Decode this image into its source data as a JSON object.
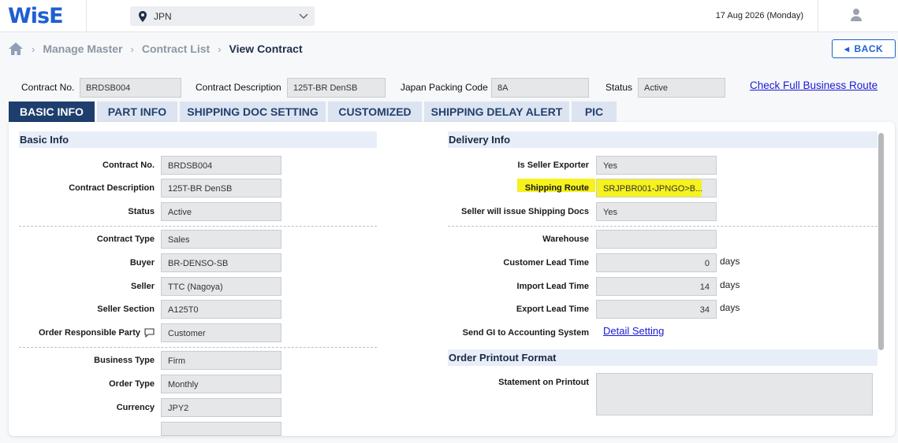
{
  "header": {
    "logo": "WisE",
    "region": "JPN",
    "date": "17 Aug 2026 (Monday)"
  },
  "breadcrumb": {
    "items": [
      "Manage Master",
      "Contract List"
    ],
    "current": "View Contract"
  },
  "back_label": "BACK",
  "contract_header": {
    "contract_no_label": "Contract No.",
    "contract_no": "BRDSB004",
    "contract_desc_label": "Contract Description",
    "contract_desc": "125T-BR DenSB",
    "packing_code_label": "Japan Packing Code",
    "packing_code": "8A",
    "status_label": "Status",
    "status": "Active",
    "full_route_link": "Check Full Business Route"
  },
  "tabs": [
    "BASIC INFO",
    "PART INFO",
    "SHIPPING DOC SETTING",
    "CUSTOMIZED",
    "SHIPPING DELAY ALERT",
    "PIC"
  ],
  "basic_info": {
    "title": "Basic Info",
    "fields": [
      {
        "label": "Contract No.",
        "value": "BRDSB004"
      },
      {
        "label": "Contract Description",
        "value": "125T-BR DenSB"
      },
      {
        "label": "Status",
        "value": "Active"
      },
      {
        "label": "Contract Type",
        "value": "Sales"
      },
      {
        "label": "Buyer",
        "value": "BR-DENSO-SB"
      },
      {
        "label": "Seller",
        "value": "TTC (Nagoya)"
      },
      {
        "label": "Seller Section",
        "value": "A125T0"
      },
      {
        "label": "Order Responsible Party",
        "value": "Customer"
      },
      {
        "label": "Business Type",
        "value": "Firm"
      },
      {
        "label": "Order Type",
        "value": "Monthly"
      },
      {
        "label": "Currency",
        "value": "JPY2"
      }
    ]
  },
  "delivery_info": {
    "title": "Delivery Info",
    "fields": [
      {
        "label": "Is Seller Exporter",
        "value": "Yes"
      },
      {
        "label": "Shipping Route",
        "value": "SRJPBR001-JPNGO>B..."
      },
      {
        "label": "Seller will issue Shipping Docs",
        "value": "Yes"
      },
      {
        "label": "Warehouse",
        "value": ""
      },
      {
        "label": "Customer Lead Time",
        "value": "0",
        "unit": "days"
      },
      {
        "label": "Import Lead Time",
        "value": "14",
        "unit": "days"
      },
      {
        "label": "Export Lead Time",
        "value": "34",
        "unit": "days"
      },
      {
        "label": "Send GI to Accounting System",
        "link": "Detail Setting"
      }
    ]
  },
  "printout": {
    "title": "Order Printout Format",
    "statement_label": "Statement on Printout",
    "statement_value": ""
  },
  "colors": {
    "brand": "#1f5fd1",
    "active_tab": "#1e3e6e",
    "highlight": "#f6f21d",
    "link": "#1a1ad6"
  }
}
